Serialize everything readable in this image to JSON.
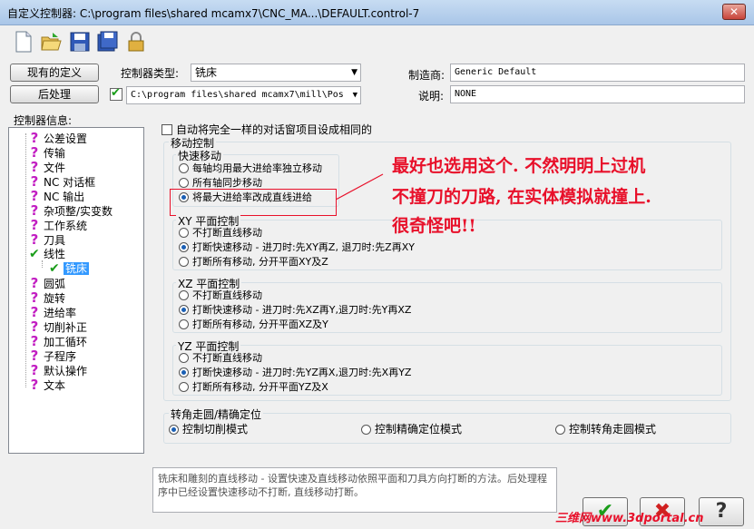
{
  "window": {
    "title": "自定义控制器: C:\\program files\\shared mcamx7\\CNC_MA...\\DEFAULT.control-7",
    "close": "✕"
  },
  "toolbar": {
    "icons": [
      "new-file-icon",
      "open-folder-icon",
      "save-icon",
      "save-as-icon",
      "lock-icon"
    ]
  },
  "buttons": {
    "existing": "现有的定义",
    "post": "后处理"
  },
  "controller_type": {
    "label": "控制器类型:",
    "value": "铣床"
  },
  "post_path": {
    "value": "C:\\program files\\shared mcamx7\\mill\\Pos"
  },
  "manufacturer": {
    "label": "制造商:",
    "value": "Generic Default"
  },
  "description": {
    "label": "说明:",
    "value": "NONE"
  },
  "tree": {
    "label": "控制器信息:",
    "items": [
      "公差设置",
      "传输",
      "文件",
      "NC 对话框",
      "NC 输出",
      "杂项整/实变数",
      "工作系统",
      "刀具",
      "线性",
      "铣床",
      "圆弧",
      "旋转",
      "进给率",
      "切削补正",
      "加工循环",
      "子程序",
      "默认操作",
      "文本"
    ]
  },
  "auto_checkbox": "自动将完全一样的对话窗项目设成相同的",
  "motion": {
    "title": "移动控制",
    "rapid": {
      "title": "快速移动",
      "options": [
        "每轴均用最大进给率独立移动",
        "所有轴同步移动",
        "将最大进给率改成直线进给"
      ]
    },
    "xy": {
      "title": "XY 平面控制",
      "options": [
        "不打断直线移动",
        "打断快速移动 - 进刀时:先XY再Z, 退刀时:先Z再XY",
        "打断所有移动, 分开平面XY及Z"
      ]
    },
    "xz": {
      "title": "XZ 平面控制",
      "options": [
        "不打断直线移动",
        "打断快速移动 - 进刀时:先XZ再Y,退刀时:先Y再XZ",
        "打断所有移动, 分开平面XZ及Y"
      ]
    },
    "yz": {
      "title": "YZ 平面控制",
      "options": [
        "不打断直线移动",
        "打断快速移动 - 进刀时:先YZ再X,退刀时:先X再YZ",
        "打断所有移动, 分开平面YZ及X"
      ]
    }
  },
  "corner": {
    "title": "转角走圆/精确定位",
    "options": [
      "控制切削模式",
      "控制精确定位模式",
      "控制转角走圆模式"
    ]
  },
  "annotation": [
    "最好也选用这个. 不然明明上过机",
    "不撞刀的刀路, 在实体模拟就撞上.",
    "很奇怪吧!!"
  ],
  "help_text": "铣床和雕刻的直线移动 - 设置快速及直线移动依照平面和刀具方向打断的方法。后处理程序中已经设置快速移动不打断, 直线移动打断。",
  "dialog_buttons": {
    "ok": "✔",
    "cancel": "✖",
    "help": "?"
  },
  "watermark": "三维网www.3dportal.cn",
  "colors": {
    "annotation": "#e8102a",
    "question": "#c21ec2",
    "check": "#1a9d1a",
    "selection": "#3399ff"
  }
}
